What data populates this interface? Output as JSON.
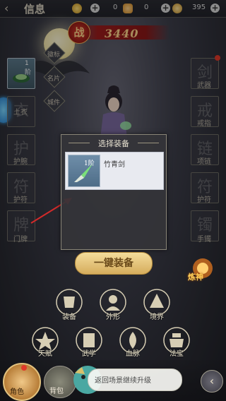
{
  "header": {
    "title": "信息",
    "back_icon": "back-arrow-icon"
  },
  "resources": [
    {
      "icon": "gold-coin-icon",
      "value": "0",
      "color": "#e9c23a"
    },
    {
      "icon": "ingot-icon",
      "value": "0",
      "color": "#f0b040"
    },
    {
      "icon": "yuanbao-icon",
      "value": "395",
      "color": "#e8b33c"
    }
  ],
  "power": {
    "badge": "战",
    "value": "3440"
  },
  "side_menu": [
    "徽标",
    "名片",
    "城件"
  ],
  "left_slots": [
    {
      "label": "",
      "tier": "1阶",
      "equipped": true
    },
    {
      "label": "上衣"
    },
    {
      "label": "护腕"
    },
    {
      "label": "护符"
    },
    {
      "label": "门牌"
    }
  ],
  "right_slots": [
    {
      "label": "武器"
    },
    {
      "label": "戒指"
    },
    {
      "label": "项链"
    },
    {
      "label": "护符"
    },
    {
      "label": "手镯"
    }
  ],
  "dialog": {
    "title": "选择装备",
    "items": [
      {
        "tier": "1阶",
        "name": "竹青剑"
      }
    ]
  },
  "equip_button": "一键装备",
  "refine_label": "炼神",
  "functions_row1": [
    "装备",
    "外形",
    "境界"
  ],
  "functions_row2": [
    "天赋",
    "武学",
    "血脉",
    "法宝"
  ],
  "bottom": {
    "nav_character": "角色",
    "nav_bag": "背包",
    "return_text": "返回场景继续升级"
  }
}
